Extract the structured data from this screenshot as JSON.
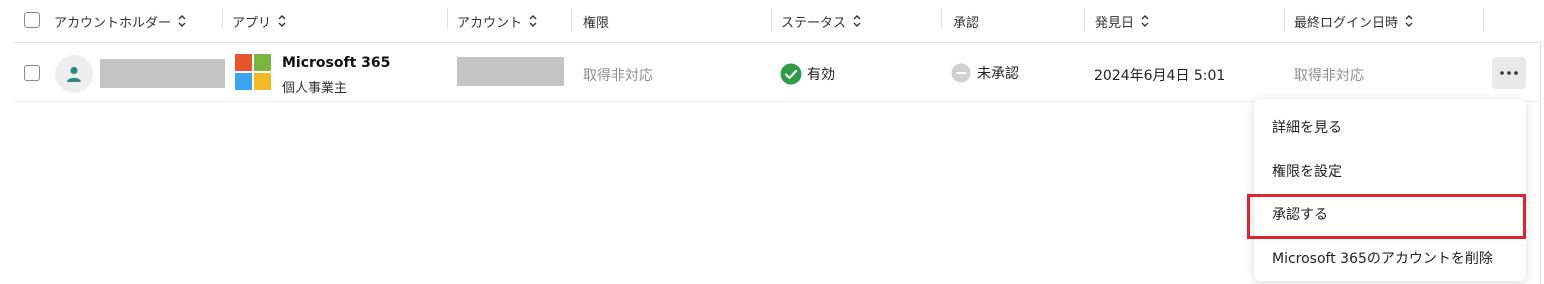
{
  "header": {
    "account_holder": "アカウントホルダー",
    "app": "アプリ",
    "account": "アカウント",
    "permission": "権限",
    "status": "ステータス",
    "approval": "承認",
    "discovered_date": "発見日",
    "last_login": "最終ログイン日時"
  },
  "row": {
    "app_name": "Microsoft 365",
    "app_plan": "個人事業主",
    "permission": "取得非対応",
    "status": "有効",
    "approval": "未承認",
    "discovered_date": "2024年6月4日 5:01",
    "last_login": "取得非対応"
  },
  "menu": {
    "items": [
      "詳細を見る",
      "権限を設定",
      "承認する",
      "Microsoft 365のアカウントを削除"
    ]
  },
  "colors": {
    "status_active": "#2e9b47",
    "approval_pending": "#d0d0d0",
    "highlight": "#e0242f",
    "ms_red": "#e8532d",
    "ms_green": "#7ab540",
    "ms_blue": "#3aa4ee",
    "ms_yellow": "#f5b928"
  },
  "icons": {
    "sort": "sort-icon",
    "avatar": "user-icon",
    "status": "check-circle-icon",
    "approval": "minus-circle-icon",
    "more": "more-horizontal-icon"
  }
}
